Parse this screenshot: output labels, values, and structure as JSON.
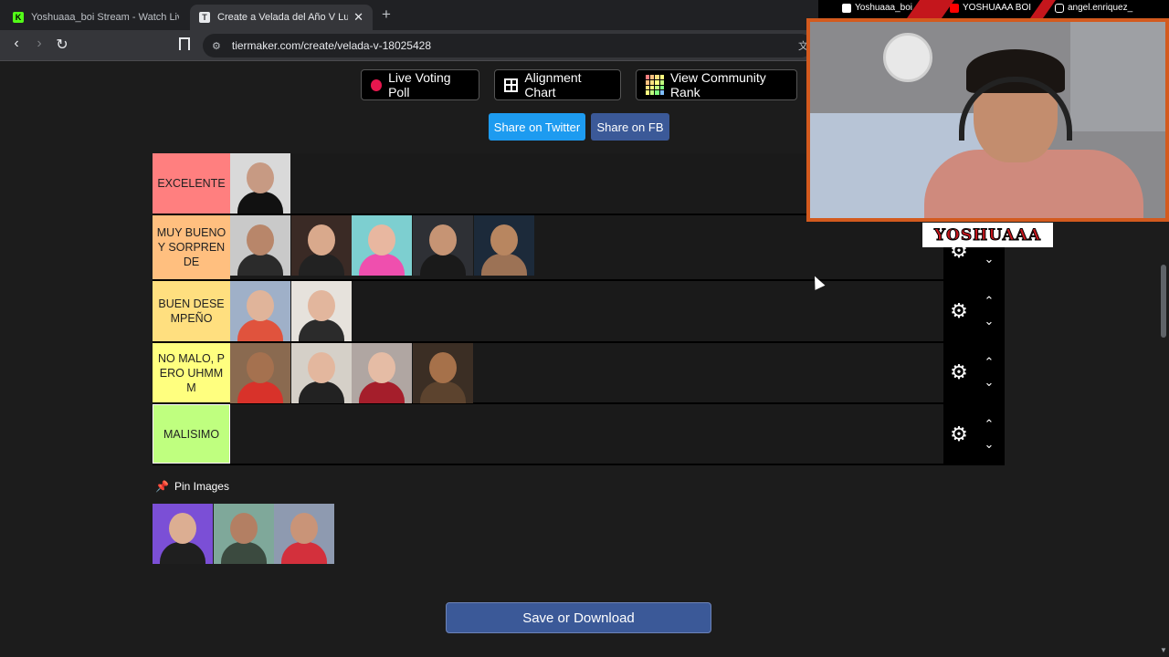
{
  "browser": {
    "tabs": [
      {
        "title": "Yoshuaaa_boi Stream - Watch Live on Kick",
        "favicon": "K"
      },
      {
        "title": "Create a Velada del Año V Lucha Tier List",
        "favicon": "T"
      }
    ],
    "close_tab": "✕",
    "new_tab": "+",
    "url": "tiermaker.com/create/velada-v-18025428",
    "site_info_icon": "⚙",
    "translate_icon": "文",
    "back_icon": "‹",
    "forward_icon": "›",
    "reload_icon": "↻"
  },
  "actions": {
    "live_poll": "Live Voting Poll",
    "alignment_chart": "Alignment Chart",
    "community_rank": "View Community Rank",
    "share_twitter": "Share on Twitter",
    "share_fb": "Share on FB",
    "save": "Save or Download"
  },
  "tiers": [
    {
      "label": "EXCELENTE",
      "color": "#ff7f7f",
      "items": [
        {
          "name": "thumb-1",
          "bg": "#d9d9d9",
          "skin": "#c79a83",
          "cloth": "#111111"
        }
      ]
    },
    {
      "label": "MUY BUENO Y SORPRENDE",
      "color": "#ffbf7f",
      "items": [
        {
          "name": "thumb-1",
          "bg": "#c9c9c9",
          "skin": "#b8866a",
          "cloth": "#2b2b2b"
        },
        {
          "name": "thumb-2",
          "bg": "#3a2a25",
          "skin": "#d9a98c",
          "cloth": "#222222"
        },
        {
          "name": "thumb-3",
          "bg": "#7dcfd0",
          "skin": "#e8b7a0",
          "cloth": "#ef4fae"
        },
        {
          "name": "thumb-4",
          "bg": "#2e3035",
          "skin": "#c69474",
          "cloth": "#1a1a1a"
        },
        {
          "name": "thumb-5",
          "bg": "#1c2a3a",
          "skin": "#b88660",
          "cloth": "#9c7255"
        }
      ]
    },
    {
      "label": "BUEN DESEMPEÑO",
      "color": "#ffdf7f",
      "items": [
        {
          "name": "thumb-1",
          "bg": "#9fb0c8",
          "skin": "#e0b49a",
          "cloth": "#e0533d"
        },
        {
          "name": "thumb-2",
          "bg": "#e6e2dc",
          "skin": "#e2b69d",
          "cloth": "#2b2b2b"
        }
      ]
    },
    {
      "label": "NO MALO, PERO UHMMM",
      "color": "#ffff7f",
      "items": [
        {
          "name": "thumb-1",
          "bg": "#8a6a50",
          "skin": "#a5714f",
          "cloth": "#d8322a"
        },
        {
          "name": "thumb-2",
          "bg": "#d5d0c8",
          "skin": "#e3b79e",
          "cloth": "#222222"
        },
        {
          "name": "thumb-3",
          "bg": "#b0a6a2",
          "skin": "#e5bca5",
          "cloth": "#a51e2b"
        },
        {
          "name": "thumb-4",
          "bg": "#3b2e24",
          "skin": "#a6714a",
          "cloth": "#5c432e"
        }
      ]
    },
    {
      "label": "MALISIMO",
      "color": "#bfff7f",
      "items": []
    }
  ],
  "tier_controls": {
    "settings_icon": "⚙",
    "up_icon": "⌃",
    "down_icon": "⌄"
  },
  "pin": {
    "title": "Pin Images",
    "icon": "📌",
    "items": [
      {
        "name": "pin-thumb-1",
        "bg": "#7b4fd6",
        "skin": "#dcae92",
        "cloth": "#1f1f1f"
      },
      {
        "name": "pin-thumb-2",
        "bg": "#7fa89a",
        "skin": "#b37f63",
        "cloth": "#3b4a3f"
      },
      {
        "name": "pin-thumb-3",
        "bg": "#8e9ab0",
        "skin": "#c99478",
        "cloth": "#d3303c"
      }
    ]
  },
  "stream": {
    "tiktok": "Yoshuaaa_boi",
    "youtube": "YOSHUAAA BOI",
    "instagram": "angel.enriquez_",
    "logo": "YOSHUAAA",
    "border_color": "#d35a1e"
  }
}
